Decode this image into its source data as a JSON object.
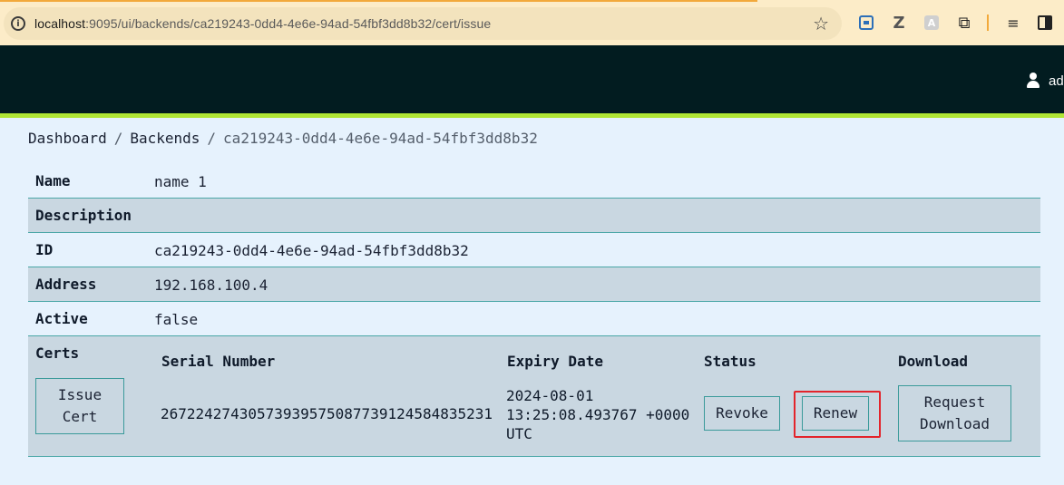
{
  "browser": {
    "url_host": "localhost",
    "url_rest": ":9095/ui/backends/ca219243-0dd4-4e6e-94ad-54fbf3dd8b32/cert/issue"
  },
  "header": {
    "user_name": "ad"
  },
  "breadcrumb": {
    "items": [
      "Dashboard",
      "Backends",
      "ca219243-0dd4-4e6e-94ad-54fbf3dd8b32"
    ],
    "separator": "/"
  },
  "details": {
    "name_label": "Name",
    "name_value": "name 1",
    "description_label": "Description",
    "description_value": "",
    "id_label": "ID",
    "id_value": "ca219243-0dd4-4e6e-94ad-54fbf3dd8b32",
    "address_label": "Address",
    "address_value": "192.168.100.4",
    "active_label": "Active",
    "active_value": "false",
    "certs_label": "Certs"
  },
  "certs": {
    "issue_button": "Issue Cert",
    "columns": [
      "Serial Number",
      "Expiry Date",
      "Status",
      "Download"
    ],
    "rows": [
      {
        "serial": "267224274305739395750877391245848352 31",
        "serial_full": "26722427430573939575087739124584835231",
        "expiry": "2024-08-01 13:25:08.493767 +0000 UTC",
        "revoke_label": "Revoke",
        "renew_label": "Renew",
        "download_label": "Request Download"
      }
    ]
  },
  "colors": {
    "header_bg": "#021c20",
    "accent": "#b0e635",
    "page_bg": "#e6f2fd",
    "row_shade": "#c9d7e1",
    "border": "#4aa7a7",
    "highlight": "#e3242b"
  }
}
